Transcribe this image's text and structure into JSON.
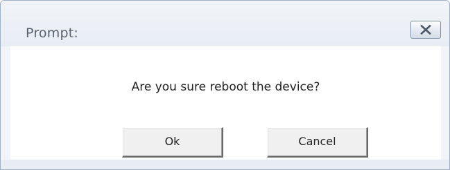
{
  "dialog": {
    "title": "Prompt:",
    "close_icon": "close-x-icon",
    "message": "Are you sure reboot the device?",
    "ok_label": "Ok",
    "cancel_label": "Cancel"
  }
}
